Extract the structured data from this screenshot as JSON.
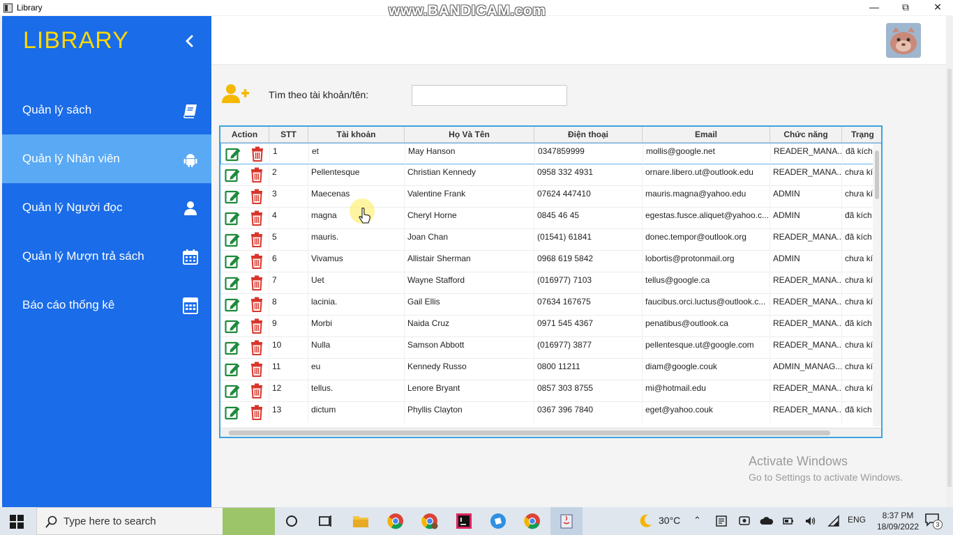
{
  "window": {
    "title": "Library",
    "watermark": "www.BANDICAM.com",
    "btn_min": "—",
    "btn_restore": "⧉",
    "btn_close": "✕"
  },
  "sidebar": {
    "logo": "LIBRARY",
    "items": [
      {
        "label": "Quản lý sách",
        "icon": "book-icon",
        "active": false
      },
      {
        "label": "Quản lý Nhân viên",
        "icon": "android-icon",
        "active": true
      },
      {
        "label": "Quản lý Người đọc",
        "icon": "user-icon",
        "active": false
      },
      {
        "label": "Quản lý Mượn trả sách",
        "icon": "calendar-icon",
        "active": false
      },
      {
        "label": "Báo cáo thống kê",
        "icon": "calculator-icon",
        "active": false
      }
    ]
  },
  "search": {
    "label": "Tìm theo tài khoản/tên:",
    "value": ""
  },
  "table": {
    "headers": [
      "Action",
      "STT",
      "Tài khoản",
      "Họ Và Tên",
      "Điện thoại",
      "Email",
      "Chức năng",
      "Trạng"
    ],
    "rows": [
      [
        "1",
        "et",
        "May Hanson",
        "0347859999",
        "mollis@google.net",
        "READER_MANA...",
        "đã kích"
      ],
      [
        "2",
        "Pellentesque",
        "Christian Kennedy",
        "0958 332 4931",
        "ornare.libero.ut@outlook.edu",
        "READER_MANA...",
        "chưa kíc"
      ],
      [
        "3",
        "Maecenas",
        "Valentine Frank",
        "07624 447410",
        "mauris.magna@yahoo.edu",
        "ADMIN",
        "chưa kíc"
      ],
      [
        "4",
        "magna",
        "Cheryl Horne",
        "0845 46 45",
        "egestas.fusce.aliquet@yahoo.c...",
        "ADMIN",
        "đã kích"
      ],
      [
        "5",
        "mauris.",
        "Joan Chan",
        "(01541) 61841",
        "donec.tempor@outlook.org",
        "READER_MANA...",
        "đã kích"
      ],
      [
        "6",
        "Vivamus",
        "Allistair Sherman",
        "0968 619 5842",
        "lobortis@protonmail.org",
        "ADMIN",
        "chưa kíc"
      ],
      [
        "7",
        "Uet",
        "Wayne Stafford",
        "(016977) 7103",
        "tellus@google.ca",
        "READER_MANA...",
        "chưa kíc"
      ],
      [
        "8",
        "lacinia.",
        "Gail Ellis",
        "07634 167675",
        "faucibus.orci.luctus@outlook.c...",
        "READER_MANA...",
        "chưa kíc"
      ],
      [
        "9",
        "Morbi",
        "Naida Cruz",
        "0971 545 4367",
        "penatibus@outlook.ca",
        "READER_MANA...",
        "đã kích"
      ],
      [
        "10",
        "Nulla",
        "Samson Abbott",
        "(016977) 3877",
        "pellentesque.ut@google.com",
        "READER_MANA...",
        "chưa kíc"
      ],
      [
        "11",
        "eu",
        "Kennedy Russo",
        "0800 11211",
        "diam@google.couk",
        "ADMIN_MANAG...",
        "chưa kíc"
      ],
      [
        "12",
        "tellus.",
        "Lenore Bryant",
        "0857 303 8755",
        "mi@hotmail.edu",
        "READER_MANA...",
        "chưa kíc"
      ],
      [
        "13",
        "dictum",
        "Phyllis Clayton",
        "0367 396 7840",
        "eget@yahoo.couk",
        "READER_MANA...",
        "đã kích"
      ]
    ]
  },
  "activate": {
    "line1": "Activate Windows",
    "line2": "Go to Settings to activate Windows."
  },
  "taskbar": {
    "search_placeholder": "Type here to search",
    "weather": "30°C",
    "lang": "ENG",
    "time": "8:37 PM",
    "date": "18/09/2022",
    "notifications": "3"
  },
  "colors": {
    "sidebar": "#1a6ce8",
    "active": "#5aa9f4",
    "logo": "#ffd700",
    "edit": "#1e8a3c",
    "delete": "#d9352b",
    "table_border": "#3aa3e0"
  }
}
